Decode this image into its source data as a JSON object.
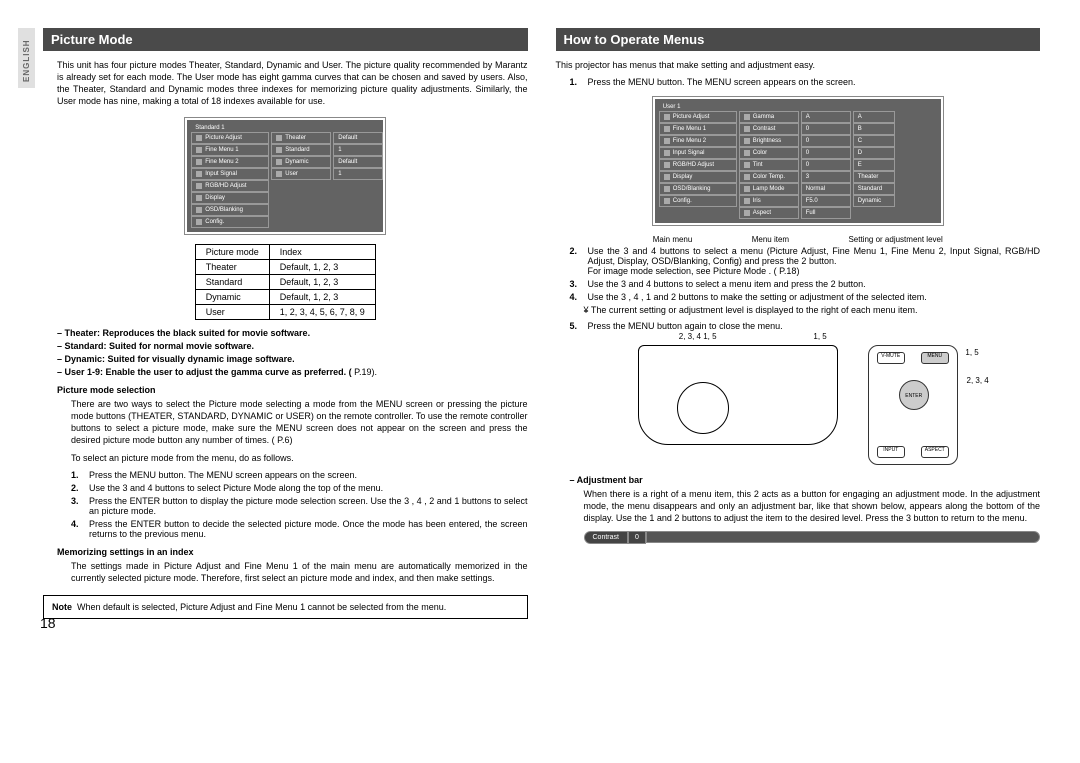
{
  "side_tab": "ENGLISH",
  "page_number": "18",
  "left": {
    "header": "Picture Mode",
    "intro": "This unit has four picture modes Theater, Standard, Dynamic and User. The picture quality recommended by Marantz is already set for each mode. The User mode has eight gamma curves that can be chosen and saved by users. Also, the Theater, Standard and Dynamic modes three indexes for memorizing picture quality adjustments. Similarly, the User mode has nine, making a total of 18 indexes available for use.",
    "menu_title": "Standard 1",
    "menu_col1": [
      "Picture Adjust",
      "Fine Menu 1",
      "Fine Menu 2",
      "Input Signal",
      "RGB/HD Adjust",
      "Display",
      "OSD/Blanking",
      "Config."
    ],
    "menu_col2": [
      "Theater",
      "Standard",
      "Dynamic",
      "User"
    ],
    "menu_col3": [
      "Default",
      "1",
      "Default",
      "1"
    ],
    "table": {
      "h1": "Picture mode",
      "h2": "Index",
      "rows": [
        [
          "Theater",
          "Default, 1, 2, 3"
        ],
        [
          "Standard",
          "Default, 1, 2, 3"
        ],
        [
          "Dynamic",
          "Default, 1, 2, 3"
        ],
        [
          "User",
          "1, 2, 3, 4, 5, 6, 7, 8, 9"
        ]
      ]
    },
    "b1": "– Theater: Reproduces the black suited for movie software.",
    "b2": "– Standard: Suited for normal movie software.",
    "b3": "– Dynamic: Suited for visually dynamic image software.",
    "b4": "– User 1-9: Enable the user to adjust the gamma curve as preferred. (",
    "b4ref": "P.19).",
    "sel_head": "Picture mode selection",
    "sel_para": "There are two ways to select the Picture mode selecting a mode from the MENU screen or pressing the picture mode buttons (THEATER, STANDARD, DYNAMIC or USER) on the remote controller. To use the remote controller buttons to select a picture mode, make sure the MENU screen does not appear on the screen and press the desired picture mode button any number of times. (        P.6)",
    "sel_para2": "To select an picture mode from the menu, do as follows.",
    "steps": [
      {
        "n": "1.",
        "t": "Press the MENU button. The MENU screen appears on the screen."
      },
      {
        "n": "2.",
        "t": "Use the 3 and 4 buttons to select Picture Mode along the top of the menu."
      },
      {
        "n": "3.",
        "t": "Press the ENTER button to display the picture mode selection screen. Use the 3 , 4 , 2 and 1 buttons to select an picture mode."
      },
      {
        "n": "4.",
        "t": "Press the ENTER button to decide the selected picture mode. Once the mode has been entered, the screen returns to the previous menu."
      }
    ],
    "mem_head": "Memorizing settings in an index",
    "mem_para": "The settings made in Picture Adjust and Fine Menu 1 of the main menu are automatically memorized in the currently selected picture mode. Therefore, first select an picture mode and index, and then make settings.",
    "note_label": "Note",
    "note": "When default is selected, Picture Adjust and Fine Menu 1 cannot be selected from the menu."
  },
  "right": {
    "header": "How to Operate Menus",
    "intro": "This projector has menus that make setting and adjustment easy.",
    "step1n": "1.",
    "step1t": "Press the MENU button. The MENU screen appears on the screen.",
    "menu_title": "User 1",
    "menu_col1": [
      "Picture Adjust",
      "Fine Menu 1",
      "Fine Menu 2",
      "Input Signal",
      "RGB/HD Adjust",
      "Display",
      "OSD/Blanking",
      "Config."
    ],
    "menu_col2": [
      "Gamma",
      "Contrast",
      "Brightness",
      "Color",
      "Tint",
      "Color Temp.",
      "Lamp Mode",
      "Iris",
      "Aspect"
    ],
    "menu_col3": [
      "A",
      "0",
      "0",
      "0",
      "0",
      "3",
      "Normal",
      "F5.0",
      "Full"
    ],
    "menu_col4": [
      "A",
      "B",
      "C",
      "D",
      "E",
      "Theater",
      "Standard",
      "Dynamic"
    ],
    "lbl_main": "Main menu",
    "lbl_item": "Menu item",
    "lbl_set": "Setting or adjustment level",
    "step2n": "2.",
    "step2t": "Use the 3 and 4 buttons to select a menu (Picture Adjust, Fine Menu 1, Fine Menu 2, Input Signal, RGB/HD Adjust, Display, OSD/Blanking, Config) and press the 2 button.",
    "step2b": "For image mode selection, see Picture Mode . (        P.18)",
    "step3n": "3.",
    "step3t": "Use the 3 and 4 buttons to select a menu item and press the 2 button.",
    "step4n": "4.",
    "step4t": "Use the 3 , 4 , 1 and 2 buttons to make the setting or adjustment of the selected item.",
    "star": "The current setting or adjustment level is displayed to the right of each menu item.",
    "step5n": "5.",
    "step5t": "Press the MENU button again to close the menu.",
    "proj_lbl1": "2, 3, 4    1, 5",
    "proj_lbl2": "1, 5",
    "rem_lbl1": "1, 5",
    "rem_lbl2": "2, 3, 4",
    "rbt_vmute": "V-MUTE",
    "rbt_menu": "MENU",
    "rbt_enter": "ENTER",
    "rbt_input": "INPUT",
    "rbt_aspect": "ASPECT",
    "adj_head": "– Adjustment bar",
    "adj_para": "When there is a      right of a menu item, this 2 acts as a button for engaging an adjustment mode. In the adjustment mode, the menu disappears and only an adjustment bar, like that shown below, appears along the bottom of the display. Use the 1 and 2 buttons to adjust the item to the desired level. Press the 3 button to return to the menu.",
    "bar_label": "Contrast",
    "bar_value": "0"
  }
}
